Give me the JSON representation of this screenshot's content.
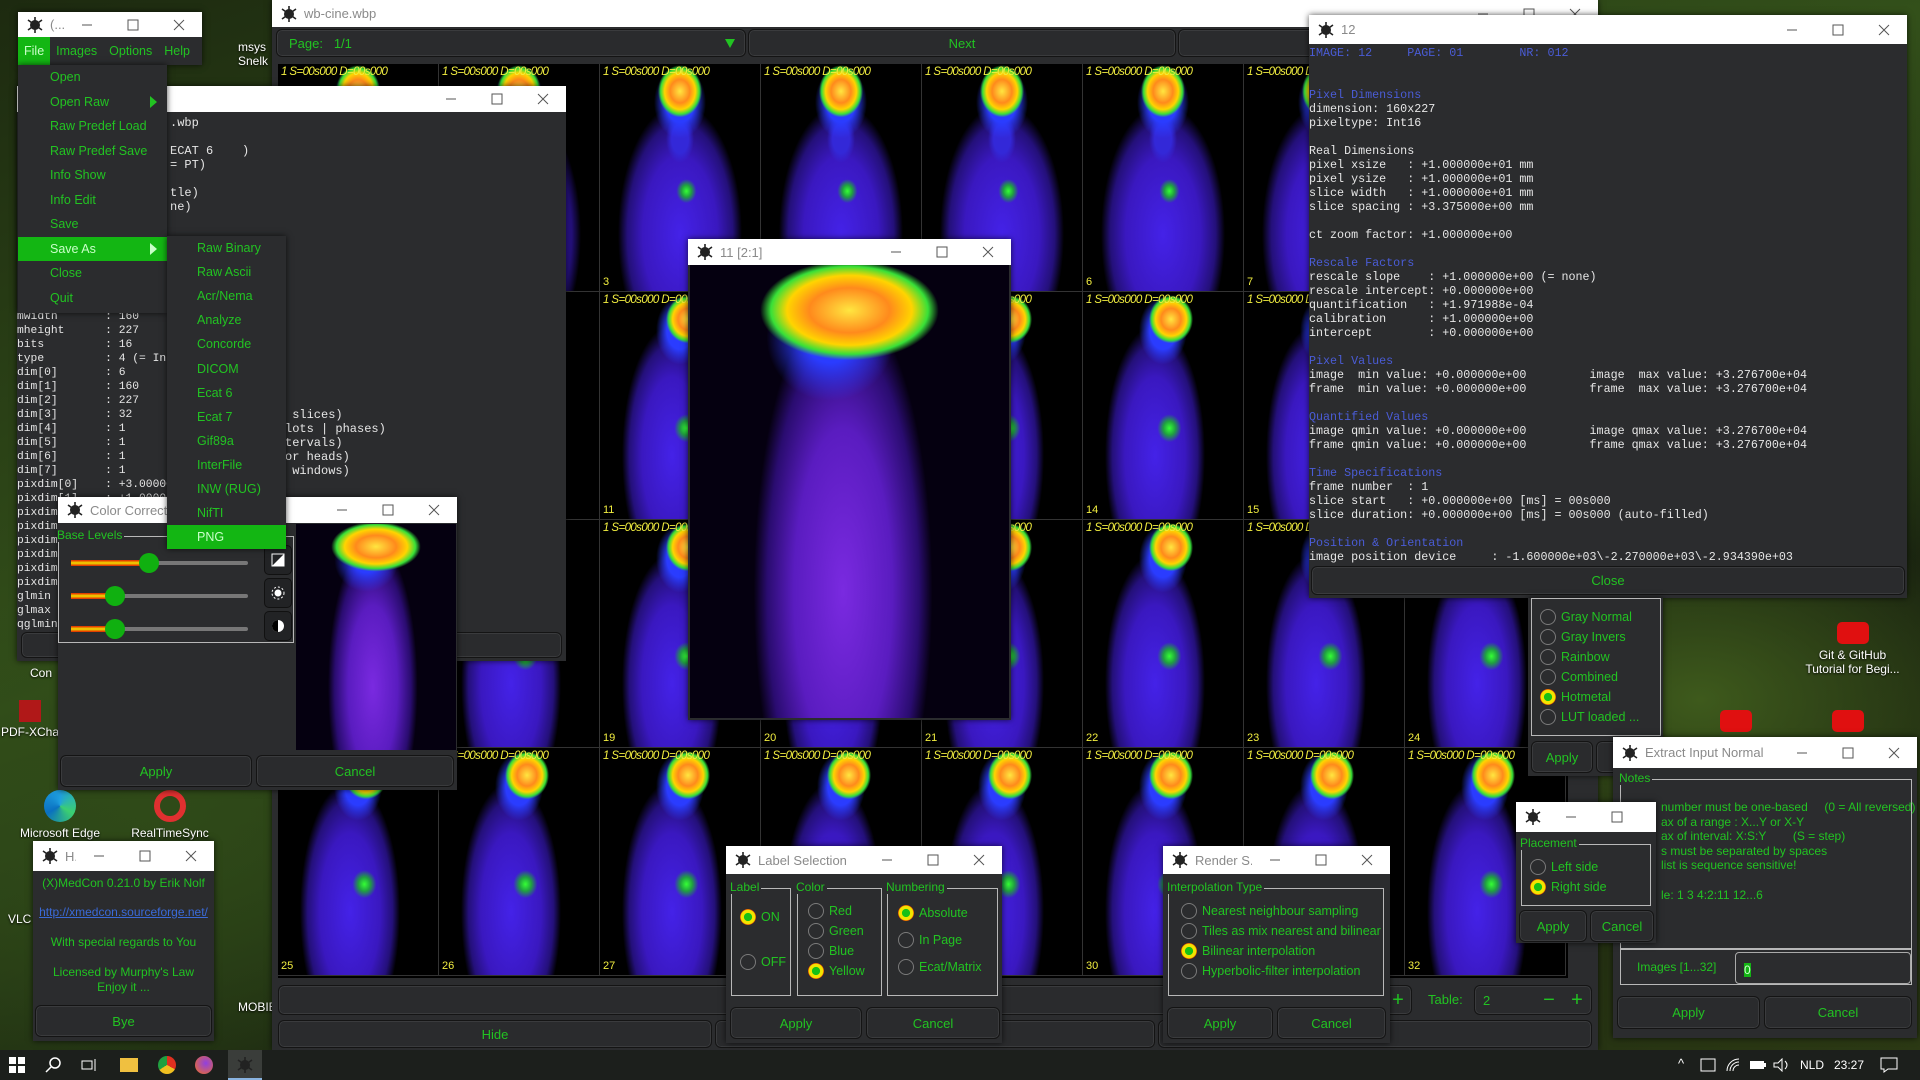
{
  "desktop": {
    "icons": [
      {
        "label": "msys",
        "sub": "Snelk"
      },
      {
        "label": "Con"
      },
      {
        "label": "PDF-XCha"
      },
      {
        "label": "Microsoft Edge"
      },
      {
        "label": "RealTimeSync"
      },
      {
        "label": "VLC"
      },
      {
        "label": "MOBIE"
      },
      {
        "label": "Git & GitHub",
        "sub": "Tutorial for Begi..."
      }
    ]
  },
  "main_window": {
    "title": "(...",
    "menubar": [
      "File",
      "Images",
      "Options",
      "Help"
    ],
    "file_menu": [
      {
        "label": "Open"
      },
      {
        "label": "Open Raw",
        "submenu": true
      },
      {
        "label": "Raw Predef Load"
      },
      {
        "label": "Raw Predef Save"
      },
      {
        "label": "Info Show"
      },
      {
        "label": "Info Edit"
      },
      {
        "label": "Save"
      },
      {
        "label": "Save As",
        "submenu": true,
        "highlighted": true
      },
      {
        "label": "Close"
      },
      {
        "label": "Quit"
      }
    ],
    "save_as_menu": [
      "Raw Binary",
      "Raw Ascii",
      "Acr/Nema",
      "Analyze",
      "Concorde",
      "DICOM",
      "Ecat 6",
      "Ecat 7",
      "Gif89a",
      "InterFile",
      "INW (RUG)",
      "NifTI",
      "PNG"
    ],
    "save_as_highlighted": "PNG"
  },
  "info_window": {
    "top_fragments": [
      ".wbp",
      "",
      "ECAT 6    )",
      "= PT)",
      "",
      "tle)",
      "ne)"
    ],
    "lines": [
      "mwidth       : 160",
      "mheight      : 227",
      "bits         : 16",
      "type         : 4 (= In",
      "dim[0]       : 6      (",
      "dim[1]       : 160    (",
      "dim[2]       : 227    (",
      "dim[3]       : 32     (",
      "dim[4]       : 1      (",
      "dim[5]       : 1      (",
      "dim[6]       : 1      (",
      "dim[7]       : 1      (",
      "pixdim[0]    : +3.00000",
      "pixdim[1]    : +1.00000",
      "pixdim",
      "pixdim",
      "pixdim",
      "pixdim",
      "pixdim",
      "pixdim",
      "glmin",
      "glmax",
      "qglmin"
    ],
    "right_fragments": [
      " slices)",
      "lots | phases)",
      "tervals)",
      "or heads)",
      " windows)"
    ]
  },
  "cine_window": {
    "title": "wb-cine.wbp",
    "page_label": "Page:",
    "page_value": "1/1",
    "next_label": "Next",
    "tile_label": "1 S=00s000 D=00s000",
    "tile_count": 32,
    "table_label": "Table:",
    "table_value": "2",
    "hide_label": "Hide"
  },
  "image_window": {
    "title": "11 [2:1]"
  },
  "image_info": {
    "title": "12",
    "close_label": "Close",
    "lines": [
      {
        "t": "IMAGE: 12     PAGE: 01        NR: 012",
        "h": true
      },
      {
        "t": ""
      },
      {
        "t": ""
      },
      {
        "t": "Pixel Dimensions",
        "h": true
      },
      {
        "t": "dimension: 160x227"
      },
      {
        "t": "pixeltype: Int16"
      },
      {
        "t": ""
      },
      {
        "t": "Real Dimensions"
      },
      {
        "t": "pixel xsize   : +1.000000e+01 mm"
      },
      {
        "t": "pixel ysize   : +1.000000e+01 mm"
      },
      {
        "t": "slice width   : +1.000000e+01 mm"
      },
      {
        "t": "slice spacing : +3.375000e+00 mm"
      },
      {
        "t": ""
      },
      {
        "t": "ct zoom factor: +1.000000e+00"
      },
      {
        "t": ""
      },
      {
        "t": "Rescale Factors",
        "h": true
      },
      {
        "t": "rescale slope    : +1.000000e+00 (= none)"
      },
      {
        "t": "rescale intercept: +0.000000e+00"
      },
      {
        "t": "quantification   : +1.971988e-04"
      },
      {
        "t": "calibration      : +1.000000e+00"
      },
      {
        "t": "intercept        : +0.000000e+00"
      },
      {
        "t": ""
      },
      {
        "t": "Pixel Values",
        "h": true
      },
      {
        "t": "image  min value: +0.000000e+00         image  max value: +3.276700e+04"
      },
      {
        "t": "frame  min value: +0.000000e+00         frame  max value: +3.276700e+04"
      },
      {
        "t": ""
      },
      {
        "t": "Quantified Values",
        "h": true
      },
      {
        "t": "image qmin value: +0.000000e+00         image qmax value: +3.276700e+04"
      },
      {
        "t": "frame qmin value: +0.000000e+00         frame qmax value: +3.276700e+04"
      },
      {
        "t": ""
      },
      {
        "t": "Time Specifications",
        "h": true
      },
      {
        "t": "frame number  : 1"
      },
      {
        "t": "slice start   : +0.000000e+00 [ms] = 00s000"
      },
      {
        "t": "slice duration: +0.000000e+00 [ms] = 00s000 (auto-filled)"
      },
      {
        "t": ""
      },
      {
        "t": "Position & Orientation",
        "h": true
      },
      {
        "t": "image position device     : -1.600000e+03\\-2.270000e+03\\-2.934390e+03"
      }
    ]
  },
  "colormap": {
    "options": [
      "Gray Normal",
      "Gray Invers",
      "Rainbow",
      "Combined",
      "Hotmetal",
      "LUT loaded ..."
    ],
    "selected": "Hotmetal",
    "apply_label": "Apply"
  },
  "color_correction": {
    "title": "Color Correction",
    "group": "Base Levels",
    "sliders": [
      0.44,
      0.25,
      0.25
    ],
    "apply_label": "Apply",
    "cancel_label": "Cancel"
  },
  "label_selection": {
    "title": "Label Selection",
    "label_group": "Label",
    "label_options": [
      "ON",
      "OFF"
    ],
    "label_selected": "ON",
    "color_group": "Color",
    "color_options": [
      "Red",
      "Green",
      "Blue",
      "Yellow"
    ],
    "color_selected": "Yellow",
    "numbering_group": "Numbering",
    "numbering_options": [
      "Absolute",
      "In Page",
      "Ecat/Matrix"
    ],
    "numbering_selected": "Absolute",
    "apply_label": "Apply",
    "cancel_label": "Cancel"
  },
  "render": {
    "title": "Render S...",
    "group": "Interpolation Type",
    "options": [
      "Nearest neighbour sampling",
      "Tiles as mix nearest and bilinear",
      "Bilinear interpolation",
      "Hyperbolic-filter interpolation"
    ],
    "selected": "Bilinear interpolation",
    "apply_label": "Apply",
    "cancel_label": "Cancel"
  },
  "help": {
    "title": "H.",
    "line1": "(X)MedCon 0.21.0 by Erik Nolf",
    "link": "http://xmedcon.sourceforge.net/",
    "line2": "With special regards to You",
    "line3": "Licensed  by  Murphy's Law",
    "line4": "Enjoy it ...",
    "bye_label": "Bye"
  },
  "placement": {
    "group": "Placement",
    "options": [
      "Left  side",
      "Right side"
    ],
    "selected": "Right side",
    "apply_label": "Apply",
    "cancel_label": "Cancel"
  },
  "extract": {
    "title": "Extract Input Normal",
    "notes_group": "Notes",
    "notes": [
      "number must be one-based     (0 = All reversed)",
      "ax of a range : X...Y or X-Y",
      "ax of interval: X:S:Y        (S = step)",
      "s must be separated by spaces",
      "list is sequence sensitive!",
      "",
      "le: 1 3 4:2:11 12...6"
    ],
    "images_label": "Images [1...32]",
    "images_value": "0",
    "apply_label": "Apply",
    "cancel_label": "Cancel"
  },
  "taskbar": {
    "lang": "NLD",
    "time": "23:27"
  },
  "colors": {
    "accent_green": "#22c322",
    "menu_highlight": "#13b613",
    "label_yellow": "#f2ee40",
    "header_blue": "#4a5cd6",
    "window_bg": "#2b2c2e"
  }
}
